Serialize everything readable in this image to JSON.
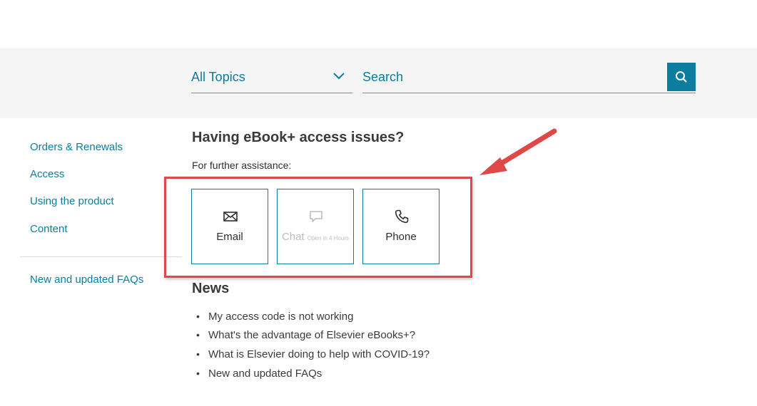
{
  "search": {
    "topic_selected": "All Topics",
    "placeholder": "Search",
    "icon": "search-icon",
    "accent_color": "#0c7d9e"
  },
  "sidebar": {
    "items": [
      {
        "label": "Orders & Renewals"
      },
      {
        "label": "Access"
      },
      {
        "label": "Using the product"
      },
      {
        "label": "Content"
      }
    ],
    "footer_link": "New and updated FAQs"
  },
  "main": {
    "heading": "Having eBook+ access issues?",
    "assist_label": "For further assistance:",
    "contact_options": [
      {
        "label": "Email",
        "icon": "envelope-icon"
      },
      {
        "label": "Chat",
        "sublabel": "Open in 4 Hours",
        "icon": "chat-bubble-icon",
        "disabled": true
      },
      {
        "label": "Phone",
        "icon": "phone-icon"
      }
    ]
  },
  "news": {
    "heading": "News",
    "items": [
      "My access code is not working",
      "What's the advantage of Elsevier eBooks+?",
      "What is Elsevier doing to help with COVID-19?",
      "New and updated FAQs"
    ]
  },
  "annotation": {
    "highlight_color": "#e04848"
  }
}
